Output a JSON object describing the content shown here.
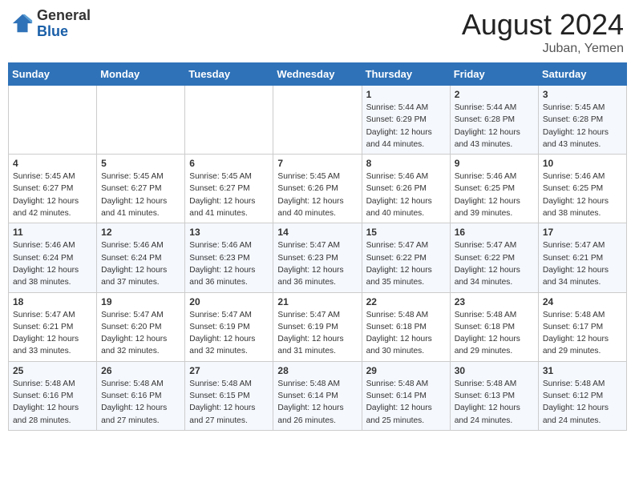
{
  "header": {
    "logo_general": "General",
    "logo_blue": "Blue",
    "month_year": "August 2024",
    "location": "Juban, Yemen"
  },
  "days_of_week": [
    "Sunday",
    "Monday",
    "Tuesday",
    "Wednesday",
    "Thursday",
    "Friday",
    "Saturday"
  ],
  "weeks": [
    [
      {
        "day": "",
        "detail": ""
      },
      {
        "day": "",
        "detail": ""
      },
      {
        "day": "",
        "detail": ""
      },
      {
        "day": "",
        "detail": ""
      },
      {
        "day": "1",
        "detail": "Sunrise: 5:44 AM\nSunset: 6:29 PM\nDaylight: 12 hours\nand 44 minutes."
      },
      {
        "day": "2",
        "detail": "Sunrise: 5:44 AM\nSunset: 6:28 PM\nDaylight: 12 hours\nand 43 minutes."
      },
      {
        "day": "3",
        "detail": "Sunrise: 5:45 AM\nSunset: 6:28 PM\nDaylight: 12 hours\nand 43 minutes."
      }
    ],
    [
      {
        "day": "4",
        "detail": "Sunrise: 5:45 AM\nSunset: 6:27 PM\nDaylight: 12 hours\nand 42 minutes."
      },
      {
        "day": "5",
        "detail": "Sunrise: 5:45 AM\nSunset: 6:27 PM\nDaylight: 12 hours\nand 41 minutes."
      },
      {
        "day": "6",
        "detail": "Sunrise: 5:45 AM\nSunset: 6:27 PM\nDaylight: 12 hours\nand 41 minutes."
      },
      {
        "day": "7",
        "detail": "Sunrise: 5:45 AM\nSunset: 6:26 PM\nDaylight: 12 hours\nand 40 minutes."
      },
      {
        "day": "8",
        "detail": "Sunrise: 5:46 AM\nSunset: 6:26 PM\nDaylight: 12 hours\nand 40 minutes."
      },
      {
        "day": "9",
        "detail": "Sunrise: 5:46 AM\nSunset: 6:25 PM\nDaylight: 12 hours\nand 39 minutes."
      },
      {
        "day": "10",
        "detail": "Sunrise: 5:46 AM\nSunset: 6:25 PM\nDaylight: 12 hours\nand 38 minutes."
      }
    ],
    [
      {
        "day": "11",
        "detail": "Sunrise: 5:46 AM\nSunset: 6:24 PM\nDaylight: 12 hours\nand 38 minutes."
      },
      {
        "day": "12",
        "detail": "Sunrise: 5:46 AM\nSunset: 6:24 PM\nDaylight: 12 hours\nand 37 minutes."
      },
      {
        "day": "13",
        "detail": "Sunrise: 5:46 AM\nSunset: 6:23 PM\nDaylight: 12 hours\nand 36 minutes."
      },
      {
        "day": "14",
        "detail": "Sunrise: 5:47 AM\nSunset: 6:23 PM\nDaylight: 12 hours\nand 36 minutes."
      },
      {
        "day": "15",
        "detail": "Sunrise: 5:47 AM\nSunset: 6:22 PM\nDaylight: 12 hours\nand 35 minutes."
      },
      {
        "day": "16",
        "detail": "Sunrise: 5:47 AM\nSunset: 6:22 PM\nDaylight: 12 hours\nand 34 minutes."
      },
      {
        "day": "17",
        "detail": "Sunrise: 5:47 AM\nSunset: 6:21 PM\nDaylight: 12 hours\nand 34 minutes."
      }
    ],
    [
      {
        "day": "18",
        "detail": "Sunrise: 5:47 AM\nSunset: 6:21 PM\nDaylight: 12 hours\nand 33 minutes."
      },
      {
        "day": "19",
        "detail": "Sunrise: 5:47 AM\nSunset: 6:20 PM\nDaylight: 12 hours\nand 32 minutes."
      },
      {
        "day": "20",
        "detail": "Sunrise: 5:47 AM\nSunset: 6:19 PM\nDaylight: 12 hours\nand 32 minutes."
      },
      {
        "day": "21",
        "detail": "Sunrise: 5:47 AM\nSunset: 6:19 PM\nDaylight: 12 hours\nand 31 minutes."
      },
      {
        "day": "22",
        "detail": "Sunrise: 5:48 AM\nSunset: 6:18 PM\nDaylight: 12 hours\nand 30 minutes."
      },
      {
        "day": "23",
        "detail": "Sunrise: 5:48 AM\nSunset: 6:18 PM\nDaylight: 12 hours\nand 29 minutes."
      },
      {
        "day": "24",
        "detail": "Sunrise: 5:48 AM\nSunset: 6:17 PM\nDaylight: 12 hours\nand 29 minutes."
      }
    ],
    [
      {
        "day": "25",
        "detail": "Sunrise: 5:48 AM\nSunset: 6:16 PM\nDaylight: 12 hours\nand 28 minutes."
      },
      {
        "day": "26",
        "detail": "Sunrise: 5:48 AM\nSunset: 6:16 PM\nDaylight: 12 hours\nand 27 minutes."
      },
      {
        "day": "27",
        "detail": "Sunrise: 5:48 AM\nSunset: 6:15 PM\nDaylight: 12 hours\nand 27 minutes."
      },
      {
        "day": "28",
        "detail": "Sunrise: 5:48 AM\nSunset: 6:14 PM\nDaylight: 12 hours\nand 26 minutes."
      },
      {
        "day": "29",
        "detail": "Sunrise: 5:48 AM\nSunset: 6:14 PM\nDaylight: 12 hours\nand 25 minutes."
      },
      {
        "day": "30",
        "detail": "Sunrise: 5:48 AM\nSunset: 6:13 PM\nDaylight: 12 hours\nand 24 minutes."
      },
      {
        "day": "31",
        "detail": "Sunrise: 5:48 AM\nSunset: 6:12 PM\nDaylight: 12 hours\nand 24 minutes."
      }
    ]
  ]
}
